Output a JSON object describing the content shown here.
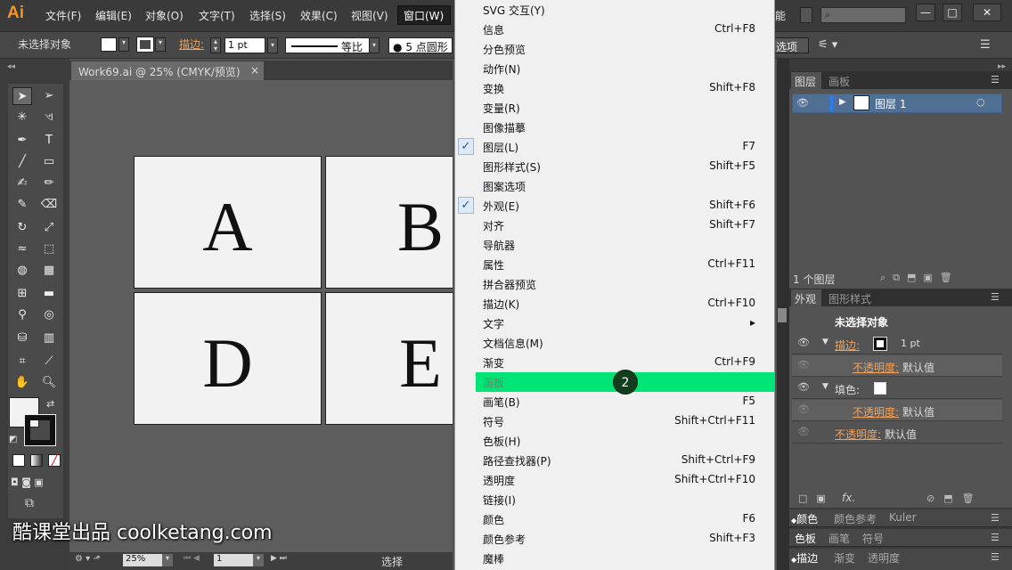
{
  "app": {
    "logo": "Ai"
  },
  "menubar": {
    "items": [
      "文件(F)",
      "编辑(E)",
      "对象(O)",
      "文字(T)",
      "选择(S)",
      "效果(C)",
      "视图(V)"
    ],
    "window_label": "窗口(W)",
    "truncated_right": "能",
    "win_min": "—",
    "win_max": "□",
    "win_close": "✕"
  },
  "control": {
    "no_selection": "未选择对象",
    "stroke_label": "描边:",
    "stroke_width": "1 pt",
    "profile": "等比",
    "brush": "5 点圆形",
    "options": "选项"
  },
  "document": {
    "tab_title": "Work69.ai @ 25% (CMYK/预览)",
    "tab_close": "×"
  },
  "artboards": [
    "A",
    "B",
    "D",
    "E"
  ],
  "status": {
    "zoom": "25%",
    "page": "1",
    "tool": "选择"
  },
  "watermark": "酷课堂出品 coolketang.com",
  "menu": {
    "items": [
      {
        "label": "SVG 交互(Y)",
        "shortcut": "",
        "checked": false
      },
      {
        "label": "信息",
        "shortcut": "Ctrl+F8",
        "checked": false
      },
      {
        "label": "分色预览",
        "shortcut": "",
        "checked": false
      },
      {
        "label": "动作(N)",
        "shortcut": "",
        "checked": false
      },
      {
        "label": "变换",
        "shortcut": "Shift+F8",
        "checked": false
      },
      {
        "label": "变量(R)",
        "shortcut": "",
        "checked": false
      },
      {
        "label": "图像描摹",
        "shortcut": "",
        "checked": false
      },
      {
        "label": "图层(L)",
        "shortcut": "F7",
        "checked": true
      },
      {
        "label": "图形样式(S)",
        "shortcut": "Shift+F5",
        "checked": false
      },
      {
        "label": "图案选项",
        "shortcut": "",
        "checked": false
      },
      {
        "label": "外观(E)",
        "shortcut": "Shift+F6",
        "checked": true
      },
      {
        "label": "对齐",
        "shortcut": "Shift+F7",
        "checked": false
      },
      {
        "label": "导航器",
        "shortcut": "",
        "checked": false
      },
      {
        "label": "属性",
        "shortcut": "Ctrl+F11",
        "checked": false
      },
      {
        "label": "拼合器预览",
        "shortcut": "",
        "checked": false
      },
      {
        "label": "描边(K)",
        "shortcut": "Ctrl+F10",
        "checked": false
      },
      {
        "label": "文字",
        "shortcut": "▸",
        "checked": false
      },
      {
        "label": "文档信息(M)",
        "shortcut": "",
        "checked": false
      },
      {
        "label": "渐变",
        "shortcut": "Ctrl+F9",
        "checked": false
      },
      {
        "label": "画板",
        "shortcut": "",
        "checked": false,
        "highlighted": true
      },
      {
        "label": "画笔(B)",
        "shortcut": "F5",
        "checked": false
      },
      {
        "label": "符号",
        "shortcut": "Shift+Ctrl+F11",
        "checked": false
      },
      {
        "label": "色板(H)",
        "shortcut": "",
        "checked": false
      },
      {
        "label": "路径查找器(P)",
        "shortcut": "Shift+Ctrl+F9",
        "checked": false
      },
      {
        "label": "透明度",
        "shortcut": "Shift+Ctrl+F10",
        "checked": false
      },
      {
        "label": "链接(I)",
        "shortcut": "",
        "checked": false
      },
      {
        "label": "颜色",
        "shortcut": "F6",
        "checked": false
      },
      {
        "label": "颜色参考",
        "shortcut": "Shift+F3",
        "checked": false
      },
      {
        "label": "魔棒",
        "shortcut": "",
        "checked": false
      }
    ],
    "check_glyph": "✓"
  },
  "step_badge": "2",
  "layers": {
    "tab_active": "图层",
    "tab_other": "画板",
    "layer_name": "图层 1",
    "count": "1 个图层"
  },
  "appearance": {
    "tab_active": "外观",
    "tab_other": "图形样式",
    "title": "未选择对象",
    "stroke_label": "描边:",
    "stroke_value": "1 pt",
    "opacity_label": "不透明度:",
    "opacity_value": "默认值",
    "fill_label": "填色:",
    "fx": "fx."
  },
  "bottom_tabs": [
    [
      "颜色",
      "颜色参考",
      "Kuler"
    ],
    [
      "色板",
      "画笔",
      "符号"
    ],
    [
      "描边",
      "渐变",
      "透明度"
    ]
  ],
  "colors": {
    "highlight": "#00e676",
    "accent_orange": "#f4a259"
  }
}
